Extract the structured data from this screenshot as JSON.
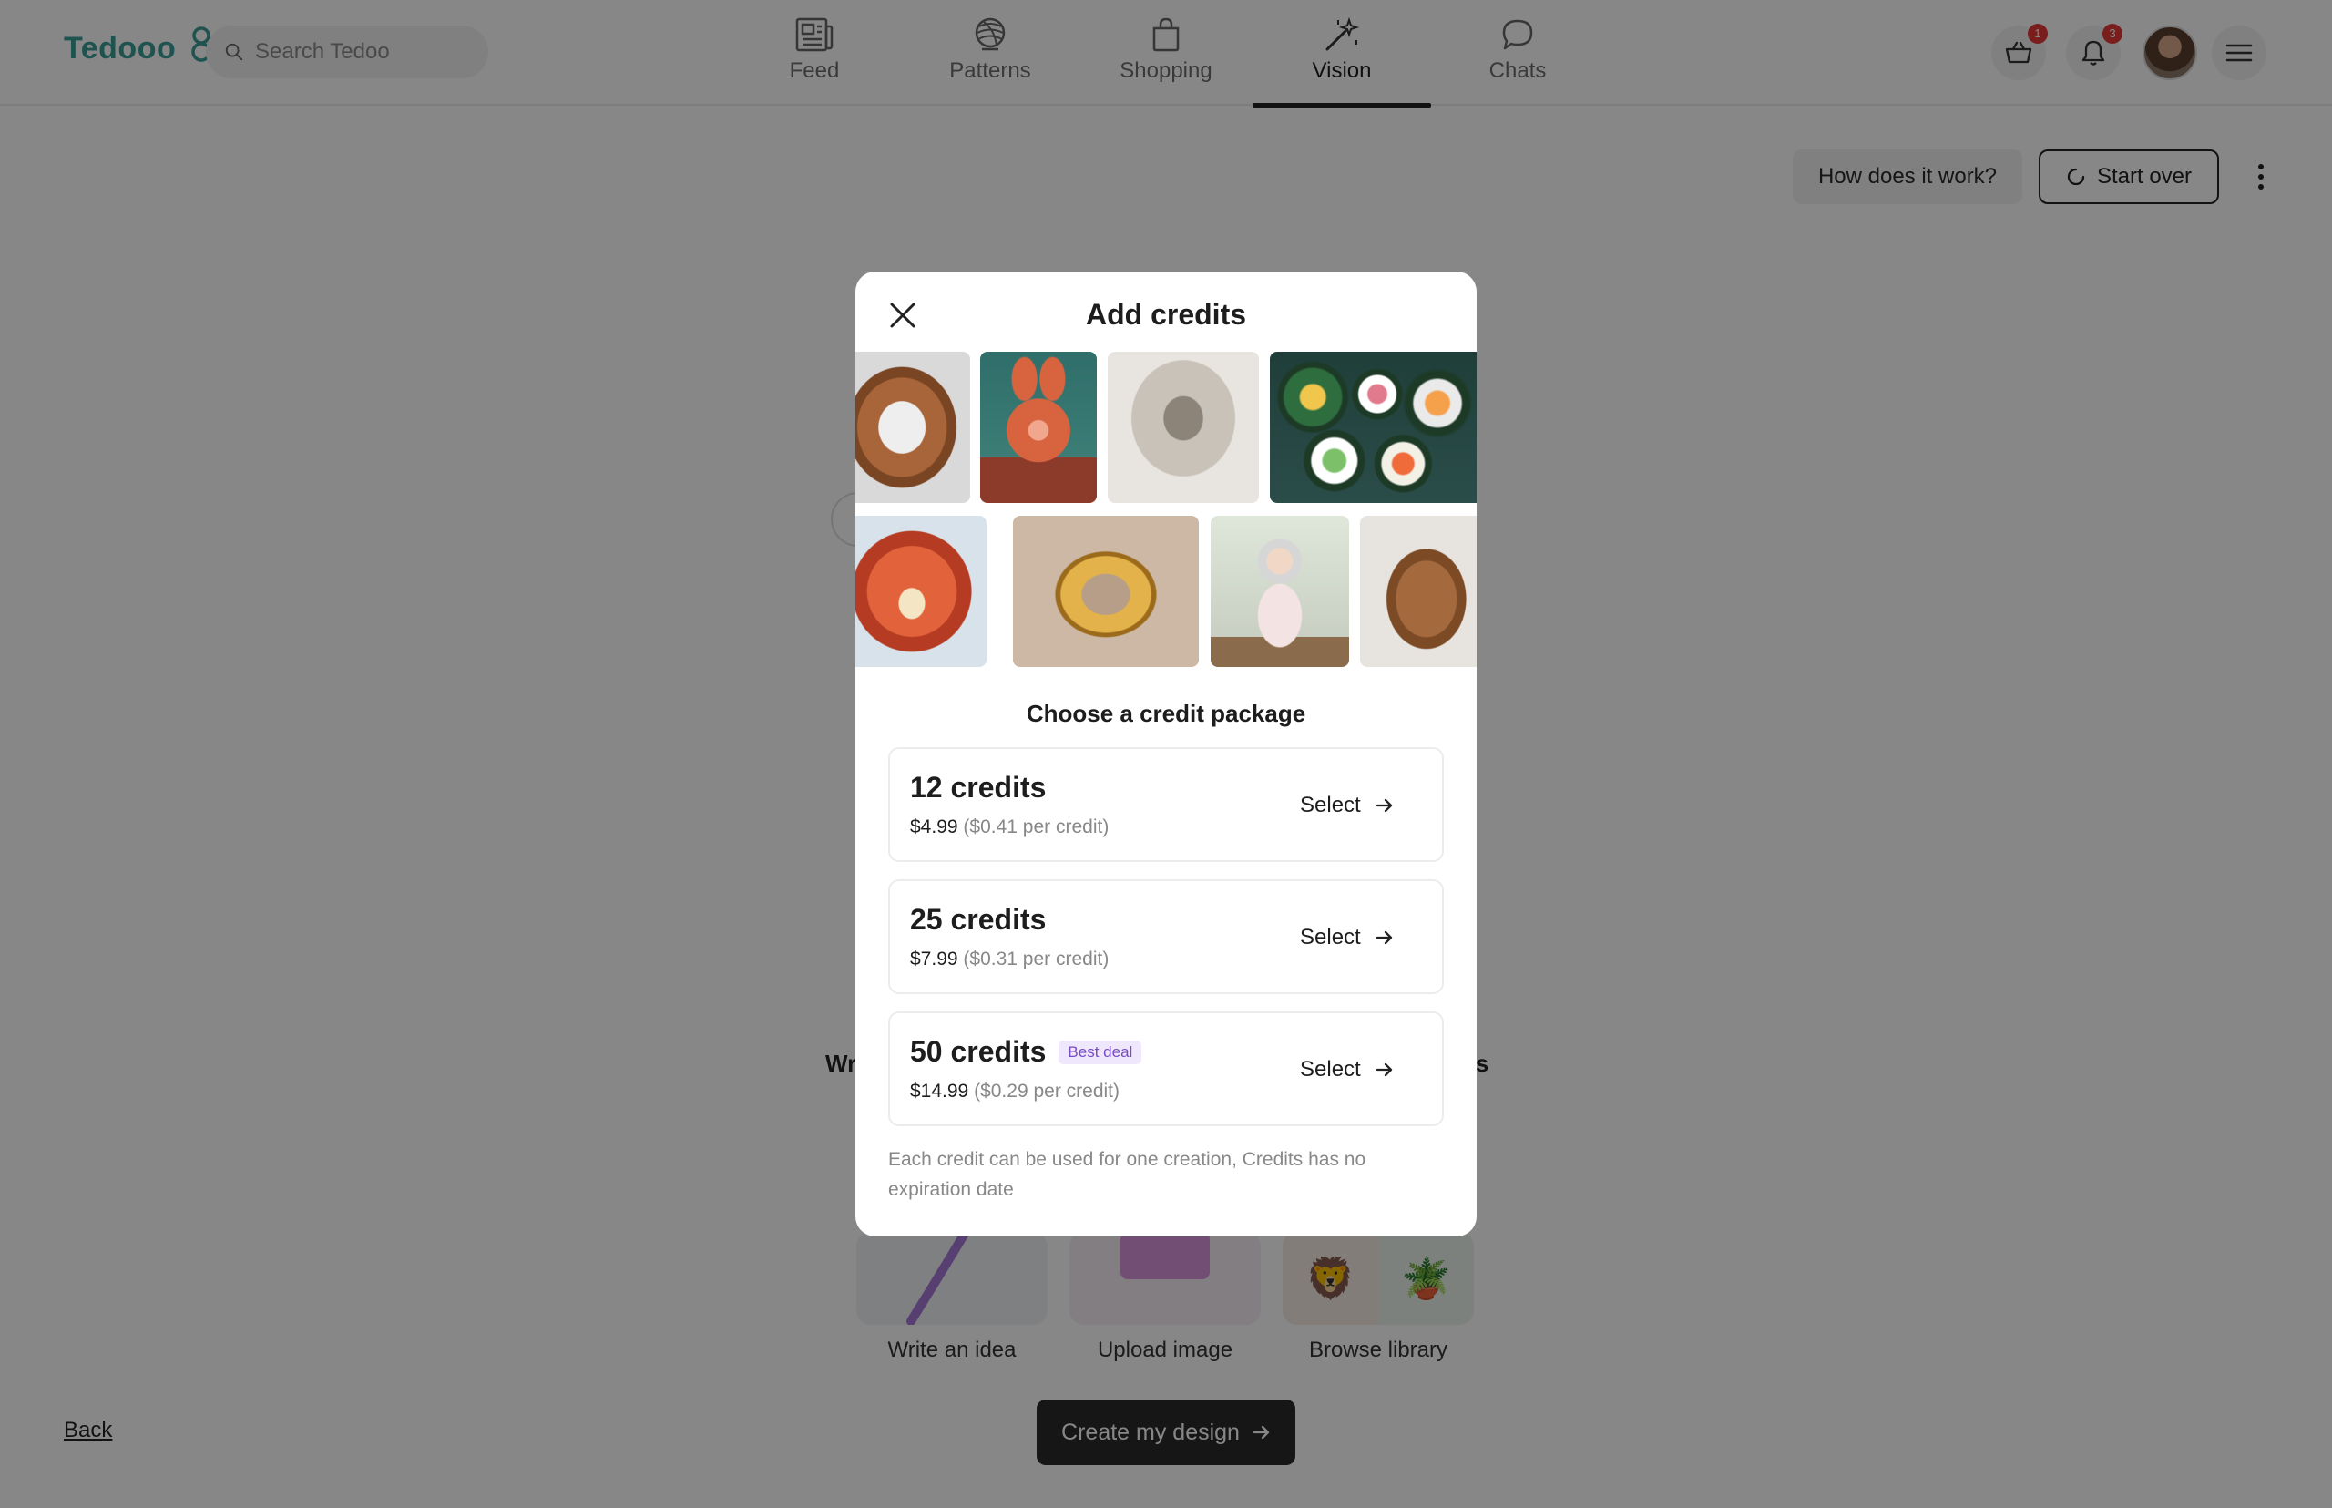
{
  "header": {
    "logo_text": "Tedooo",
    "search_placeholder": "Search Tedoo",
    "nav": [
      {
        "label": "Feed",
        "icon": "newspaper-icon"
      },
      {
        "label": "Patterns",
        "icon": "yarn-ball-icon"
      },
      {
        "label": "Shopping",
        "icon": "shopping-bag-icon"
      },
      {
        "label": "Vision",
        "icon": "magic-wand-icon",
        "active": true
      },
      {
        "label": "Chats",
        "icon": "chat-bubble-icon"
      }
    ],
    "cart_badge": "1",
    "notifications_badge": "3"
  },
  "page": {
    "how_label": "How does it work?",
    "start_over_label": "Start over",
    "bg_text_left": "Wr",
    "bg_text_right": "ns",
    "options": [
      {
        "label": "Write an idea"
      },
      {
        "label": "Upload image"
      },
      {
        "label": "Browse library"
      }
    ],
    "back_label": "Back",
    "create_label": "Create my design"
  },
  "modal": {
    "title": "Add credits",
    "section_heading": "Choose a credit package",
    "packages": [
      {
        "title": "12 credits",
        "price": "$4.99",
        "per": "($0.41 per credit)",
        "select": "Select",
        "badge": ""
      },
      {
        "title": "25 credits",
        "price": "$7.99",
        "per": "($0.31 per credit)",
        "select": "Select",
        "badge": ""
      },
      {
        "title": "50 credits",
        "price": "$14.99",
        "per": "($0.29 per credit)",
        "select": "Select",
        "badge": "Best deal"
      }
    ],
    "note": "Each credit can be used for one creation, Credits has no expiration date"
  }
}
